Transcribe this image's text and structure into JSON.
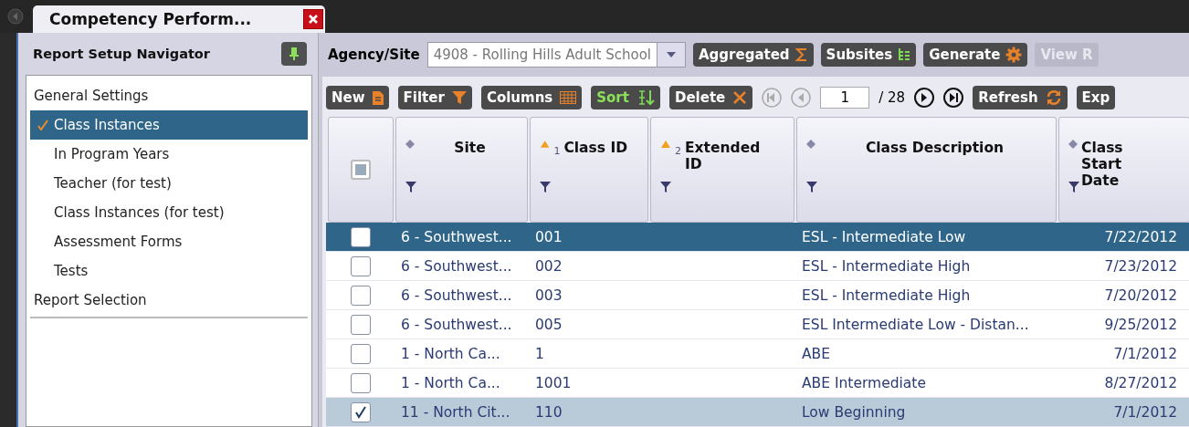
{
  "document_tab": {
    "title": "Competency Perform...",
    "selected": true
  },
  "navigator": {
    "title": "Report Setup Navigator",
    "items": [
      {
        "label": "General Settings",
        "selected": false,
        "children": [
          {
            "label": "Class Instances",
            "selected": true
          },
          {
            "label": "In Program Years",
            "selected": false
          },
          {
            "label": "Teacher (for test)",
            "selected": false
          },
          {
            "label": "Class Instances (for test)",
            "selected": false
          },
          {
            "label": "Assessment Forms",
            "selected": false
          },
          {
            "label": "Tests",
            "selected": false
          }
        ]
      },
      {
        "label": "Report Selection",
        "selected": false
      }
    ]
  },
  "agency_bar": {
    "label": "Agency/Site",
    "value": "4908 - Rolling Hills Adult School",
    "buttons": [
      {
        "label": "Aggregated",
        "disabled": false
      },
      {
        "label": "Subsites",
        "disabled": false
      },
      {
        "label": "Generate",
        "disabled": false
      },
      {
        "label": "View R",
        "disabled": true
      }
    ]
  },
  "toolbar": {
    "buttons": [
      {
        "label": "New",
        "active": false
      },
      {
        "label": "Filter",
        "active": false
      },
      {
        "label": "Columns",
        "active": false
      },
      {
        "label": "Sort",
        "active": true
      },
      {
        "label": "Delete",
        "active": false
      }
    ],
    "pager": {
      "first_disabled": true,
      "prev_disabled": true,
      "page": "1",
      "total": "/ 28"
    },
    "right_buttons": [
      {
        "label": "Refresh"
      },
      {
        "label": "Exp"
      }
    ]
  },
  "table": {
    "all_checked": false,
    "columns": [
      {
        "label": "Site",
        "sorted": false
      },
      {
        "label": "Class ID",
        "sorted": true,
        "rank": "1"
      },
      {
        "label": "Extended ID",
        "sorted": true,
        "rank": "2"
      },
      {
        "label": "Class Description",
        "sorted": false
      },
      {
        "label": "Class Start Date",
        "sorted": false
      }
    ],
    "rows": [
      {
        "selected": true,
        "checked": false,
        "cells": [
          "6 - Southwest...",
          "001",
          "",
          "ESL - Intermediate Low",
          "7/22/2012"
        ]
      },
      {
        "selected": false,
        "checked": false,
        "cells": [
          "6 - Southwest...",
          "002",
          "",
          "ESL - Intermediate High",
          "7/23/2012"
        ]
      },
      {
        "selected": false,
        "checked": false,
        "cells": [
          "6 - Southwest...",
          "003",
          "",
          "ESL - Intermediate High",
          "7/20/2012"
        ]
      },
      {
        "selected": false,
        "checked": false,
        "cells": [
          "6 - Southwest...",
          "005",
          "",
          "ESL Intermediate Low - Distan...",
          "9/25/2012"
        ]
      },
      {
        "selected": false,
        "checked": false,
        "cells": [
          "1 - North Ca...",
          "1",
          "",
          "ABE",
          "7/1/2012"
        ]
      },
      {
        "selected": false,
        "checked": false,
        "cells": [
          "1 - North Ca...",
          "1001",
          "",
          "ABE Intermediate",
          "8/27/2012"
        ]
      },
      {
        "selected": false,
        "checked": true,
        "cells": [
          "11 - North Cit...",
          "110",
          "",
          "Low Beginning",
          "7/1/2012"
        ]
      }
    ]
  }
}
